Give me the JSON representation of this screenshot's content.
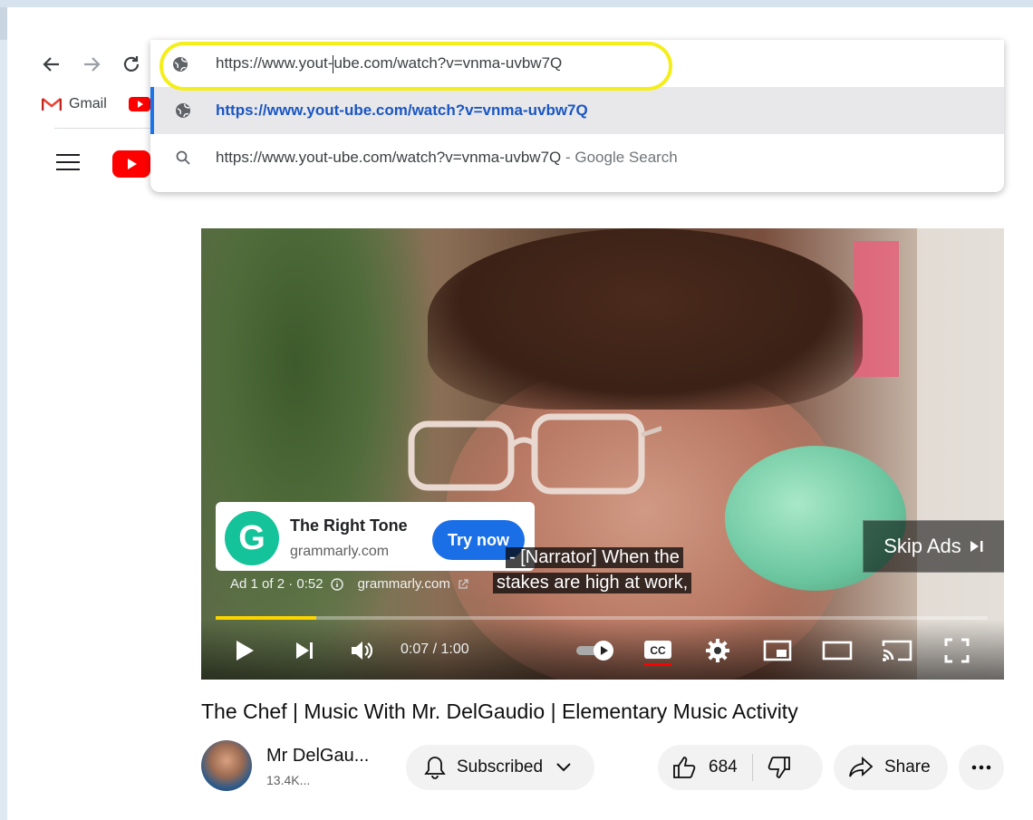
{
  "browser": {
    "bookmarks": [
      {
        "label": "Gmail",
        "icon": "gmail-icon"
      },
      {
        "label": "",
        "icon": "youtube-icon"
      }
    ],
    "omnibox": {
      "input_before_caret": "https://www.yout-",
      "input_after_caret": "ube.com/watch?v=vnma-uvbw7Q",
      "suggestion_url": "https://www.yout-ube.com/watch?v=vnma-uvbw7Q",
      "search_query": "https://www.yout-ube.com/watch?v=vnma-uvbw7Q",
      "search_suffix": " - Google Search"
    }
  },
  "player": {
    "ad": {
      "title": "The Right Tone",
      "domain": "grammarly.com",
      "cta": "Try now",
      "meta_position": "Ad 1 of 2 · 0:52",
      "meta_domain": "grammarly.com",
      "skip_label": "Skip Ads"
    },
    "captions": [
      "- [Narrator] When the",
      "stakes are high at work,"
    ],
    "time": "0:07 / 1:00",
    "progress_fraction": 0.13,
    "accent": "#fcd400"
  },
  "video": {
    "title": "The Chef | Music With Mr. DelGaudio | Elementary Music Activity",
    "channel_name": "Mr DelGau...",
    "subscribers": "13.4K...",
    "subscribe_label": "Subscribed",
    "likes": "684",
    "share_label": "Share"
  },
  "colors": {
    "highlight": "#f4ee1a",
    "link_blue": "#1a56c4",
    "youtube_red": "#ff0000"
  }
}
